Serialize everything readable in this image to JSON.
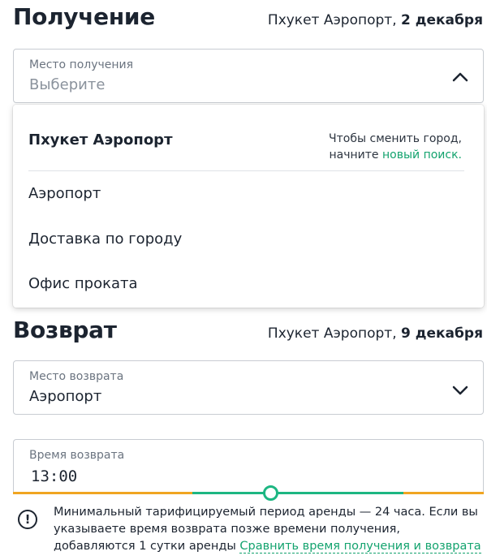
{
  "pickup": {
    "title": "Получение",
    "location_prefix": "Пхукет Аэропорт, ",
    "date": "2 декабря",
    "field_label": "Место получения",
    "field_value": "Выберите"
  },
  "dropdown": {
    "city": "Пхукет Аэропорт",
    "hint_line1": "Чтобы сменить город,",
    "hint_prefix": "начните ",
    "hint_link": "новый поиск.",
    "items": [
      "Аэропорт",
      "Доставка по городу",
      "Офис проката"
    ]
  },
  "return": {
    "title": "Возврат",
    "location_prefix": "Пхукет Аэропорт, ",
    "date": "9 декабря",
    "field_label": "Место возврата",
    "field_value": "Аэропорт"
  },
  "return_time": {
    "field_label": "Время возврата",
    "value": "13:00"
  },
  "notice": {
    "icon": "exclamation-circle-icon",
    "text": "Минимальный тарифицируемый период аренды — 24 часа. Если вы указываете время возврата позже времени получения, добавляются 1 сутки аренды ",
    "link": "Сравнить время получения и возврата"
  },
  "colors": {
    "accent_green": "#1db682",
    "link_green": "#13a36e",
    "warning_orange": "#f0a521"
  }
}
